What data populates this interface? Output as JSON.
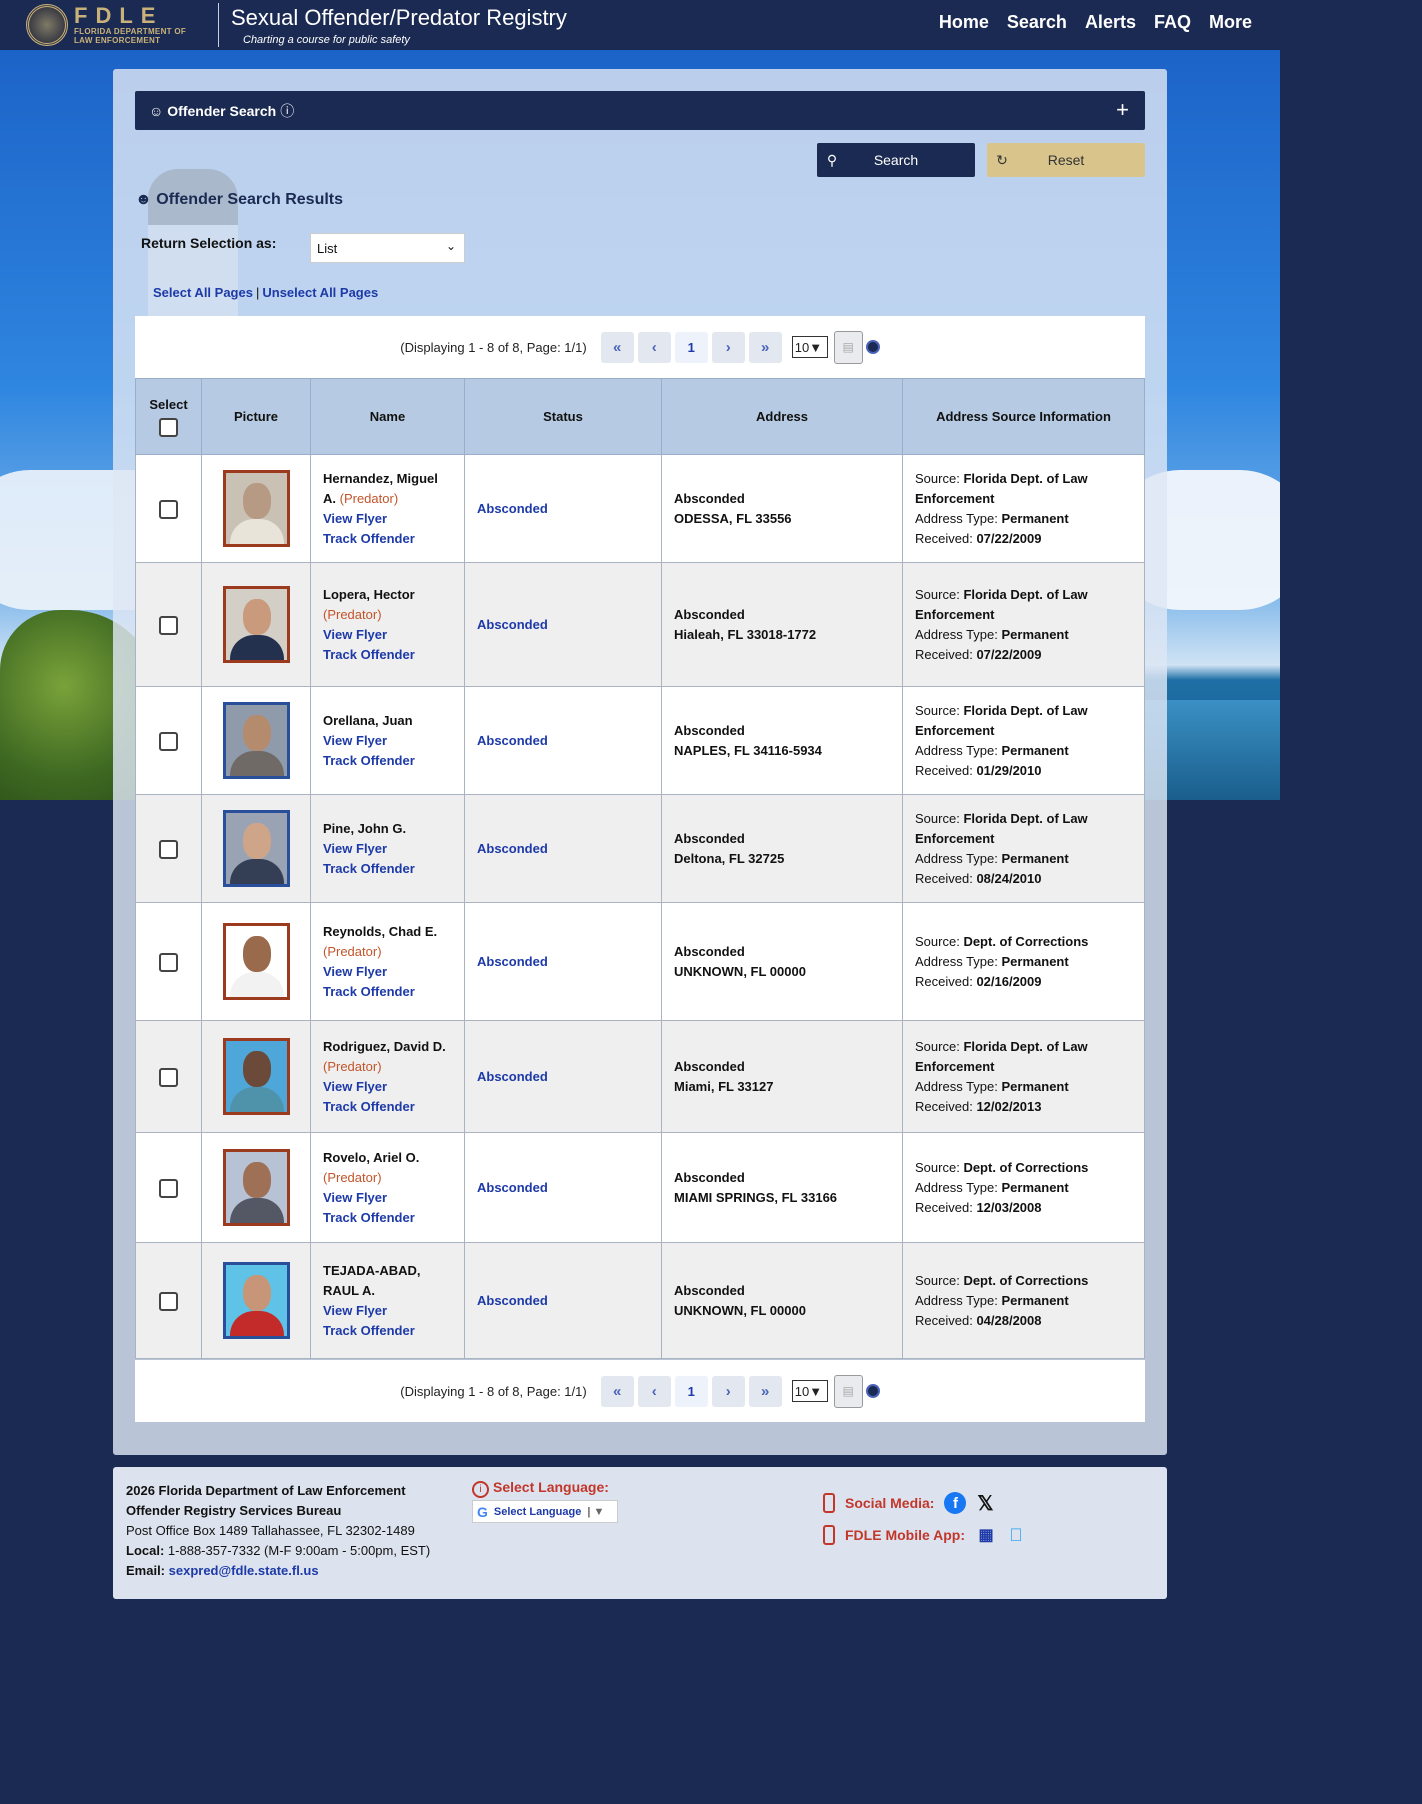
{
  "header": {
    "logo_big": "FDLE",
    "logo_small_1": "FLORIDA DEPARTMENT OF",
    "logo_small_2": "LAW ENFORCEMENT",
    "title": "Sexual Offender/Predator Registry",
    "tagline": "Charting a course for public safety",
    "nav": [
      "Home",
      "Search",
      "Alerts",
      "FAQ",
      "More"
    ]
  },
  "search_panel": {
    "title": "Offender Search",
    "search_button": "Search",
    "reset_button": "Reset"
  },
  "results": {
    "title": "Offender Search Results",
    "return_label": "Return Selection as:",
    "return_value": "List",
    "select_all": "Select All Pages",
    "unselect_all": "Unselect All Pages"
  },
  "pager": {
    "info": "(Displaying 1 - 8 of 8, Page: 1/1)",
    "current_page": "1",
    "page_size": "10"
  },
  "table": {
    "headers": [
      "Select",
      "Picture",
      "Name",
      "Status",
      "Address",
      "Address Source Information"
    ],
    "rows": [
      {
        "name": "Hernandez, Miguel A.",
        "predator": "(Predator)",
        "view": "View Flyer",
        "track": "Track Offender",
        "status": "Absconded",
        "addr1": "Absconded",
        "addr2": "ODESSA, FL 33556",
        "source_label": "Source:",
        "source": "Florida Dept. of Law Enforcement",
        "type_label": "Address Type:",
        "type": "Permanent",
        "received_label": "Received:",
        "received": "07/22/2009",
        "photo_style": "pred"
      },
      {
        "name": "Lopera, Hector",
        "predator": "(Predator)",
        "view": "View Flyer",
        "track": "Track Offender",
        "status": "Absconded",
        "addr1": "Absconded",
        "addr2": "Hialeah, FL 33018-1772",
        "source_label": "Source:",
        "source": "Florida Dept. of Law Enforcement",
        "type_label": "Address Type:",
        "type": "Permanent",
        "received_label": "Received:",
        "received": "07/22/2009",
        "photo_style": "pred"
      },
      {
        "name": "Orellana, Juan",
        "predator": "",
        "view": "View Flyer",
        "track": "Track Offender",
        "status": "Absconded",
        "addr1": "Absconded",
        "addr2": "NAPLES, FL 34116-5934",
        "source_label": "Source:",
        "source": "Florida Dept. of Law Enforcement",
        "type_label": "Address Type:",
        "type": "Permanent",
        "received_label": "Received:",
        "received": "01/29/2010",
        "photo_style": "off"
      },
      {
        "name": "Pine, John G.",
        "predator": "",
        "view": "View Flyer",
        "track": "Track Offender",
        "status": "Absconded",
        "addr1": "Absconded",
        "addr2": "Deltona, FL 32725",
        "source_label": "Source:",
        "source": "Florida Dept. of Law Enforcement",
        "type_label": "Address Type:",
        "type": "Permanent",
        "received_label": "Received:",
        "received": "08/24/2010",
        "photo_style": "off"
      },
      {
        "name": "Reynolds, Chad E.",
        "predator": "(Predator)",
        "view": "View Flyer",
        "track": "Track Offender",
        "status": "Absconded",
        "addr1": "Absconded",
        "addr2": "UNKNOWN, FL 00000",
        "source_label": "Source:",
        "source": "Dept. of Corrections",
        "type_label": "Address Type:",
        "type": "Permanent",
        "received_label": "Received:",
        "received": "02/16/2009",
        "photo_style": "pred"
      },
      {
        "name": "Rodriguez, David D.",
        "predator": "(Predator)",
        "view": "View Flyer",
        "track": "Track Offender",
        "status": "Absconded",
        "addr1": "Absconded",
        "addr2": "Miami, FL 33127",
        "source_label": "Source:",
        "source": "Florida Dept. of Law Enforcement",
        "type_label": "Address Type:",
        "type": "Permanent",
        "received_label": "Received:",
        "received": "12/02/2013",
        "photo_style": "pred"
      },
      {
        "name": "Rovelo, Ariel O.",
        "predator": "(Predator)",
        "view": "View Flyer",
        "track": "Track Offender",
        "status": "Absconded",
        "addr1": "Absconded",
        "addr2": "MIAMI SPRINGS, FL 33166",
        "source_label": "Source:",
        "source": "Dept. of Corrections",
        "type_label": "Address Type:",
        "type": "Permanent",
        "received_label": "Received:",
        "received": "12/03/2008",
        "photo_style": "pred"
      },
      {
        "name": "TEJADA-ABAD, RAUL A.",
        "predator": "",
        "view": "View Flyer",
        "track": "Track Offender",
        "status": "Absconded",
        "addr1": "Absconded",
        "addr2": "UNKNOWN, FL 00000",
        "source_label": "Source:",
        "source": "Dept. of Corrections",
        "type_label": "Address Type:",
        "type": "Permanent",
        "received_label": "Received:",
        "received": "04/28/2008",
        "photo_style": "off"
      }
    ]
  },
  "footer": {
    "line1": "2026 Florida Department of Law Enforcement",
    "line2": "Offender Registry Services Bureau",
    "line3": "Post Office Box 1489 Tallahassee, FL 32302-1489",
    "local_label": "Local:",
    "local": "1-888-357-7332 (M-F 9:00am - 5:00pm, EST)",
    "email_label": "Email:",
    "email": "sexpred@fdle.state.fl.us",
    "lang_label": "Select Language:",
    "lang_select": "Select Language",
    "social_label": "Social Media:",
    "app_label": "FDLE Mobile App:"
  },
  "colors": {
    "navy": "#1b2a52",
    "gold": "#d9c58c",
    "link": "#1d3aa8",
    "predator": "#c3542a"
  }
}
